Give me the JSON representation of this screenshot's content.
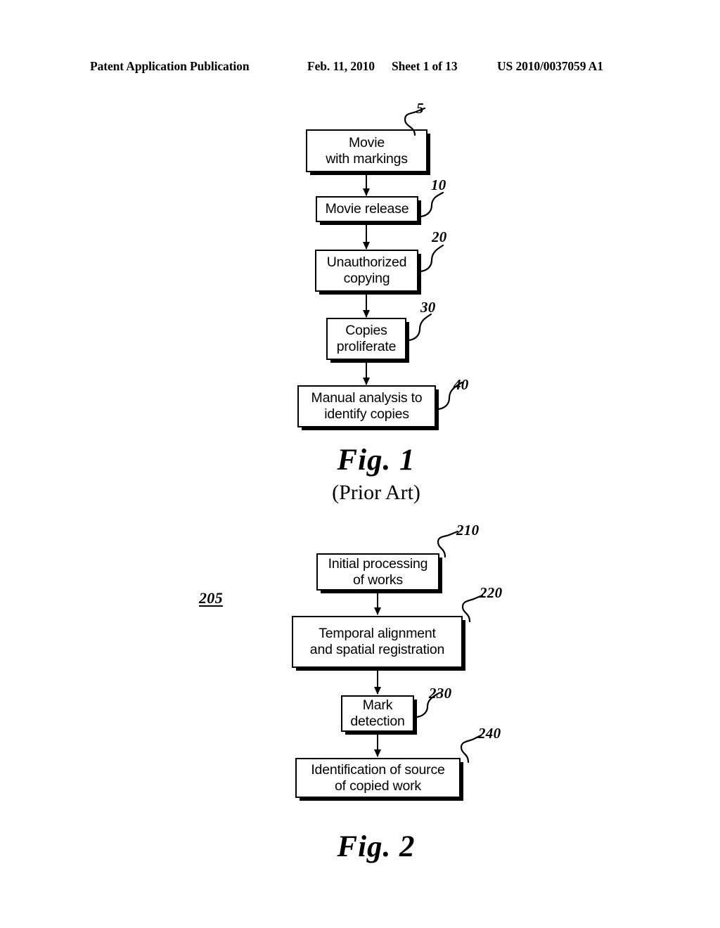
{
  "header": {
    "publication": "Patent Application Publication",
    "date": "Feb. 11, 2010",
    "sheet": "Sheet 1 of 13",
    "patent_number": "US 2010/0037059 A1"
  },
  "figures": [
    {
      "id": "fig1",
      "caption": "Fig. 1",
      "subcaption": "(Prior Art)",
      "boxes": [
        {
          "ref": "5",
          "line1": "Movie",
          "line2": "with markings"
        },
        {
          "ref": "10",
          "line1": "Movie release",
          "line2": ""
        },
        {
          "ref": "20",
          "line1": "Unauthorized",
          "line2": "copying"
        },
        {
          "ref": "30",
          "line1": "Copies",
          "line2": "proliferate"
        },
        {
          "ref": "40",
          "line1": "Manual analysis to",
          "line2": "identify copies"
        }
      ]
    },
    {
      "id": "fig2",
      "caption": "Fig. 2",
      "subcaption": "",
      "system_ref": "205",
      "boxes": [
        {
          "ref": "210",
          "line1": "Initial processing",
          "line2": "of works"
        },
        {
          "ref": "220",
          "line1": "Temporal alignment",
          "line2": "and spatial registration"
        },
        {
          "ref": "230",
          "line1": "Mark",
          "line2": "detection"
        },
        {
          "ref": "240",
          "line1": "Identification of source",
          "line2": "of copied work"
        }
      ]
    }
  ]
}
